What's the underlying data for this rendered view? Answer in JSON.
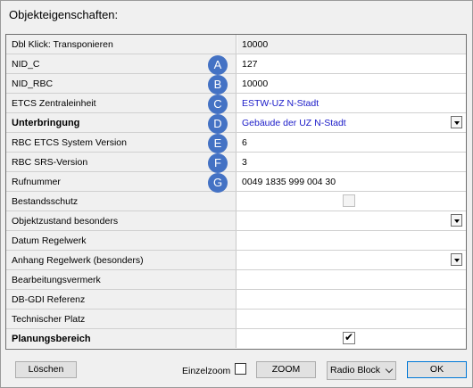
{
  "dialog": {
    "title": "Objekteigenschaften:"
  },
  "rows": [
    {
      "label": "Dbl Klick: Transponieren",
      "value": "10000",
      "bold": false
    },
    {
      "label": "NID_C",
      "value": "127",
      "badge": "A"
    },
    {
      "label": "NID_RBC",
      "value": "10000",
      "badge": "B"
    },
    {
      "label": "ETCS Zentraleinheit",
      "value": "ESTW-UZ N-Stadt",
      "badge": "C"
    },
    {
      "label": "Unterbringung",
      "value": "Gebäude der UZ N-Stadt",
      "badge": "D"
    },
    {
      "label": "RBC ETCS System Version",
      "value": "6",
      "badge": "E"
    },
    {
      "label": "RBC SRS-Version",
      "value": "3",
      "badge": "F"
    },
    {
      "label": "Rufnummer",
      "value": "0049 1835 999 004 30",
      "badge": "G"
    },
    {
      "label": "Bestandsschutz",
      "value": ""
    },
    {
      "label": "Objektzustand besonders",
      "value": ""
    },
    {
      "label": "Datum Regelwerk",
      "value": ""
    },
    {
      "label": "Anhang Regelwerk (besonders)",
      "value": ""
    },
    {
      "label": "Bearbeitungsvermerk",
      "value": ""
    },
    {
      "label": "DB-GDI Referenz",
      "value": ""
    },
    {
      "label": "Technischer Platz",
      "value": ""
    },
    {
      "label": "Planungsbereich",
      "value": "",
      "checked": true
    }
  ],
  "footer": {
    "delete_label": "Löschen",
    "einzelzoom_label": "Einzelzoom",
    "zoom_label": "ZOOM",
    "combo_value": "Radio Block",
    "ok_label": "OK"
  },
  "colors": {
    "badge": "#4472c4",
    "link_value": "#1a1ac8"
  }
}
